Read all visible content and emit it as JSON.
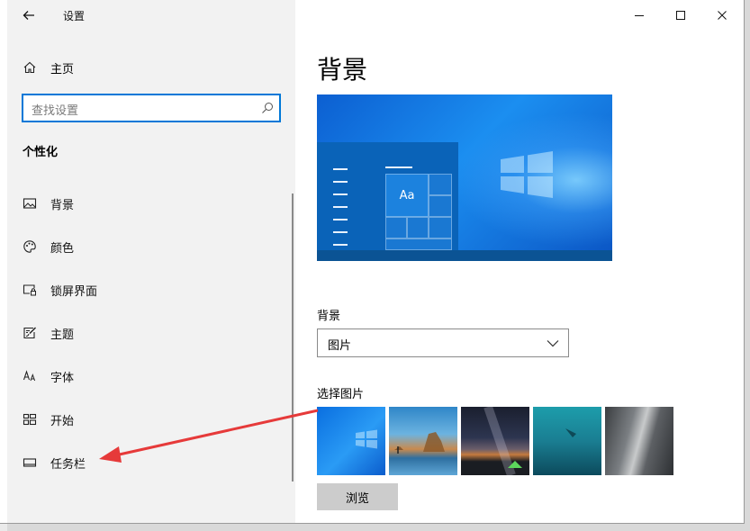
{
  "window": {
    "title": "设置"
  },
  "nav": {
    "home_label": "主页",
    "search_placeholder": "查找设置",
    "section_title": "个性化",
    "items": [
      {
        "label": "背景",
        "icon": "picture-icon"
      },
      {
        "label": "颜色",
        "icon": "palette-icon"
      },
      {
        "label": "锁屏界面",
        "icon": "lock-screen-icon"
      },
      {
        "label": "主题",
        "icon": "theme-brush-icon"
      },
      {
        "label": "字体",
        "icon": "font-icon"
      },
      {
        "label": "开始",
        "icon": "start-grid-icon"
      },
      {
        "label": "任务栏",
        "icon": "taskbar-icon"
      }
    ]
  },
  "main": {
    "page_title": "背景",
    "preview": {
      "tile_text": "Aa"
    },
    "background_label": "背景",
    "background_value": "图片",
    "choose_picture_label": "选择图片",
    "browse_label": "浏览"
  },
  "colors": {
    "accent": "#0078d7",
    "nav_bg": "#f2f2f2",
    "annotation_arrow": "#e63a3a",
    "browse_button": "#cccccc"
  }
}
